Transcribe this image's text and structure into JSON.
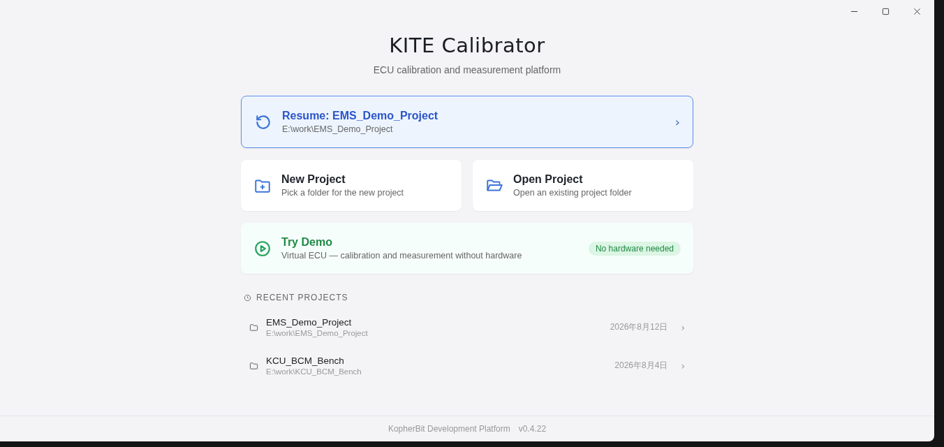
{
  "app": {
    "title": "KITE Calibrator",
    "subtitle": "ECU calibration and measurement platform"
  },
  "resume": {
    "title": "Resume: EMS_Demo_Project",
    "path": "E:\\work\\EMS_Demo_Project",
    "chevron": "›"
  },
  "actions": [
    {
      "kind": "new",
      "title": "New Project",
      "description": "Pick a folder for the new project"
    },
    {
      "kind": "open",
      "title": "Open Project",
      "description": "Open an existing project folder"
    }
  ],
  "demo": {
    "title": "Try Demo",
    "description": "Virtual ECU — calibration and measurement without hardware",
    "badge": "No hardware needed"
  },
  "recent": {
    "heading": "RECENT PROJECTS",
    "items": [
      {
        "name": "EMS_Demo_Project",
        "path": "E:\\work\\EMS_Demo_Project",
        "date": "2026年8月12日",
        "chevron": "›"
      },
      {
        "name": "KCU_BCM_Bench",
        "path": "E:\\work\\KCU_BCM_Bench",
        "date": "2026年8月4日",
        "chevron": "›"
      }
    ]
  },
  "footer": {
    "company": "KopherBit Development Platform",
    "version": "v0.4.22"
  }
}
